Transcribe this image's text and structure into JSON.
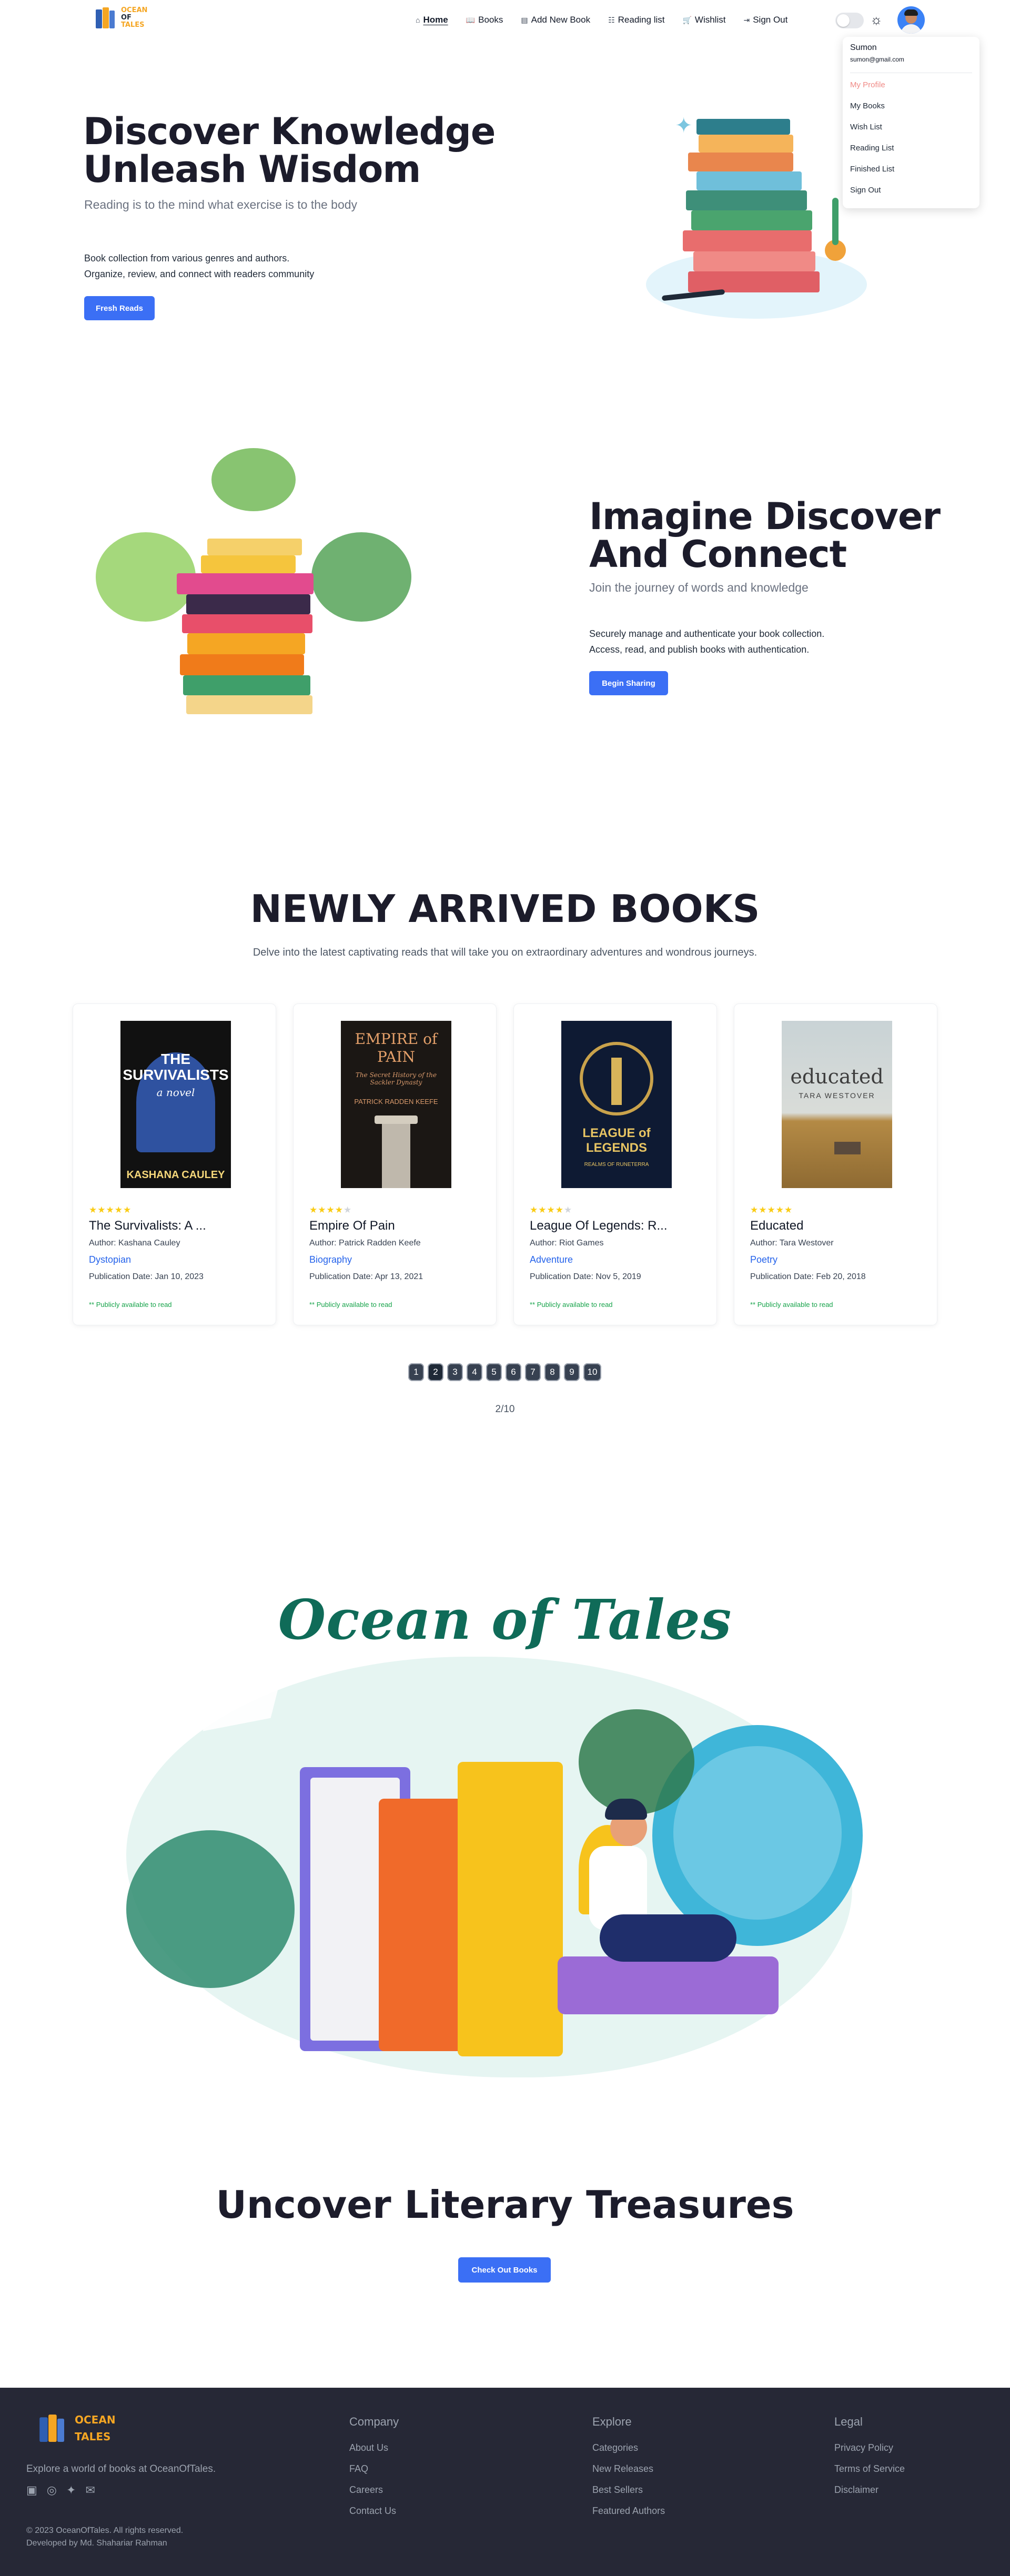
{
  "brand": {
    "line1": "OCEAN",
    "line2": "OF",
    "line3": "TALES"
  },
  "nav": {
    "items": [
      {
        "icon": "home-icon",
        "glyph": "⌂",
        "label": "Home"
      },
      {
        "icon": "book-icon",
        "glyph": "📖",
        "label": "Books"
      },
      {
        "icon": "add-book-icon",
        "glyph": "▤",
        "label": "Add New Book"
      },
      {
        "icon": "reading-list-icon",
        "glyph": "☷",
        "label": "Reading list"
      },
      {
        "icon": "wishlist-icon",
        "glyph": "🛒",
        "label": "Wishlist"
      },
      {
        "icon": "sign-out-icon",
        "glyph": "⇥",
        "label": "Sign Out"
      }
    ]
  },
  "user_menu": {
    "name": "Sumon",
    "email": "sumon@gmail.com",
    "items": [
      "My Profile",
      "My Books",
      "Wish List",
      "Reading List",
      "Finished List",
      "Sign Out"
    ]
  },
  "hero1": {
    "title_line1": "Discover Knowledge",
    "title_line2": "Unleash Wisdom",
    "subtitle": "Reading is to the mind what exercise is to the body",
    "desc_line1": "Book collection from various genres and authors.",
    "desc_line2": "Organize, review, and connect with readers community",
    "button": "Fresh Reads"
  },
  "hero2": {
    "title_line1": "Imagine Discover",
    "title_line2": "And Connect",
    "subtitle": "Join the journey of words and knowledge",
    "desc_line1": "Securely manage and authenticate your book collection.",
    "desc_line2": "Access, read, and publish books with authentication.",
    "button": "Begin Sharing"
  },
  "newly": {
    "title": "NEWLY ARRIVED BOOKS",
    "subtitle": "Delve into the latest captivating reads that will take you on extraordinary adventures and wondrous journeys.",
    "books": [
      {
        "title": "The Survivalists: A ...",
        "author": "Author: Kashana Cauley",
        "genre": "Dystopian",
        "pub": "Publication Date: Jan 10, 2023",
        "avail": "** Publicly available to read",
        "rating": 5,
        "cover_top": "THE SURVIVALISTS",
        "cover_mid": "a novel",
        "cover_bottom": "KASHANA CAULEY"
      },
      {
        "title": "Empire Of Pain",
        "author": "Author: Patrick Radden Keefe",
        "genre": "Biography",
        "pub": "Publication Date: Apr 13, 2021",
        "avail": "** Publicly available to read",
        "rating": 4,
        "cover_top": "EMPIRE of PAIN",
        "cover_mid": "The Secret History of the Sackler Dynasty",
        "cover_bottom": "PATRICK RADDEN KEEFE"
      },
      {
        "title": "League Of Legends: R...",
        "author": "Author: Riot Games",
        "genre": "Adventure",
        "pub": "Publication Date: Nov 5, 2019",
        "avail": "** Publicly available to read",
        "rating": 4,
        "cover_top": "LEAGUE of LEGENDS",
        "cover_mid": "REALMS OF RUNETERRA",
        "cover_bottom": ""
      },
      {
        "title": "Educated",
        "author": "Author: Tara Westover",
        "genre": "Poetry",
        "pub": "Publication Date: Feb 20, 2018",
        "avail": "** Publicly available to read",
        "rating": 5,
        "cover_top": "educated",
        "cover_mid": "TARA WESTOVER",
        "cover_bottom": ""
      }
    ]
  },
  "pagination": {
    "pages": [
      "1",
      "2",
      "3",
      "4",
      "5",
      "6",
      "7",
      "8",
      "9",
      "10"
    ],
    "count": "2/10"
  },
  "ocean": {
    "title": "Ocean of Tales"
  },
  "uncover": {
    "title": "Uncover Literary Treasures",
    "button": "Check Out Books"
  },
  "footer": {
    "logo_line1": "OCEAN",
    "logo_line2": "TALES",
    "tagline": "Explore a world of books at OceanOfTales.",
    "copyright": "© 2023 OceanOfTales. All rights reserved.",
    "developer": "Developed by Md. Shahariar Rahman",
    "columns": [
      {
        "heading": "Company",
        "links": [
          "About Us",
          "FAQ",
          "Careers",
          "Contact Us"
        ]
      },
      {
        "heading": "Explore",
        "links": [
          "Categories",
          "New Releases",
          "Best Sellers",
          "Featured Authors"
        ]
      },
      {
        "heading": "Legal",
        "links": [
          "Privacy Policy",
          "Terms of Service",
          "Disclaimer"
        ]
      }
    ]
  }
}
